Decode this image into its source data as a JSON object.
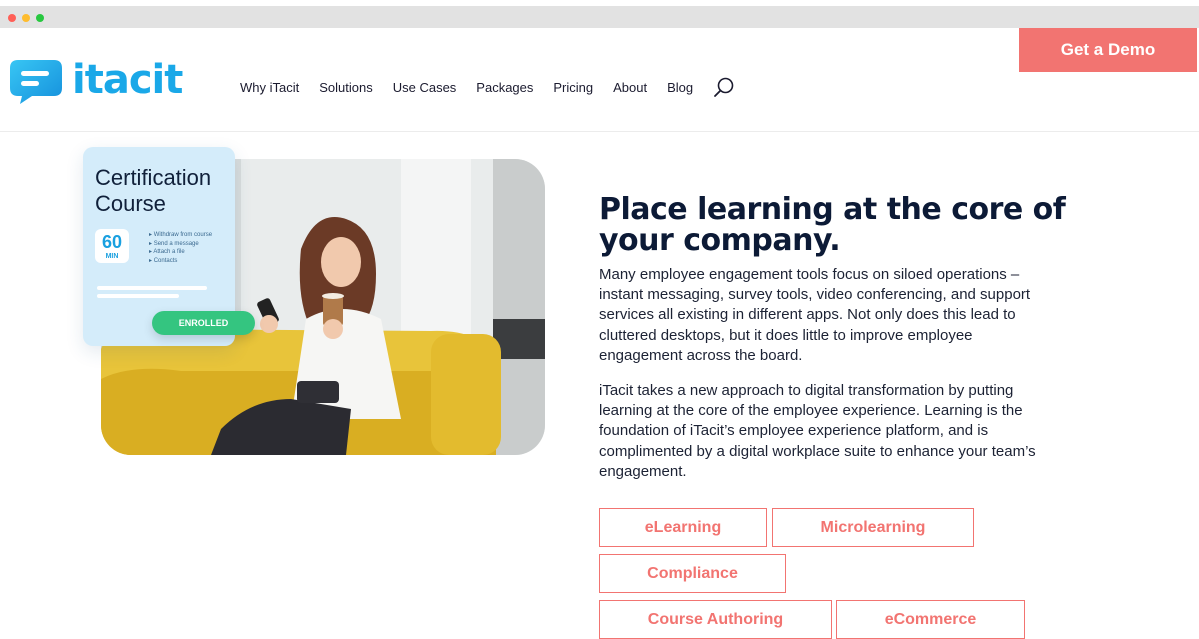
{
  "browser": {
    "traffic_lights": [
      "close",
      "minimize",
      "maximize"
    ]
  },
  "header": {
    "logo_text": "itacit",
    "nav": [
      "Why iTacit",
      "Solutions",
      "Use Cases",
      "Packages",
      "Pricing",
      "About",
      "Blog"
    ],
    "search_icon": "search-icon",
    "cta_label": "Get a Demo"
  },
  "hero_card": {
    "title": "Certification Course",
    "duration_number": "60",
    "duration_unit": "MIN",
    "actions": [
      "Withdraw from course",
      "Send a message",
      "Attach a file",
      "Contacts"
    ],
    "status": "ENROLLED"
  },
  "content": {
    "headline": "Place learning at the core of your company.",
    "paragraph_1": "Many employee engagement tools focus on siloed operations – instant messaging, survey tools, video conferencing, and support services all existing in different apps. Not only does this lead to cluttered desktops, but it does little to improve employee engagement across the board.",
    "paragraph_2": "iTacit takes a new approach to digital transformation by putting learning at the core of the employee experience. Learning is the foundation of iTacit’s employee experience platform, and is complimented by a digital workplace suite to enhance your team’s engagement.",
    "tags": [
      "eLearning",
      "Microlearning",
      "Compliance",
      "Course Authoring",
      "eCommerce"
    ]
  },
  "colors": {
    "brand_blue": "#1aa8e8",
    "accent_coral": "#f27471",
    "enrolled_green": "#34c580",
    "headline_navy": "#0c1a36"
  }
}
